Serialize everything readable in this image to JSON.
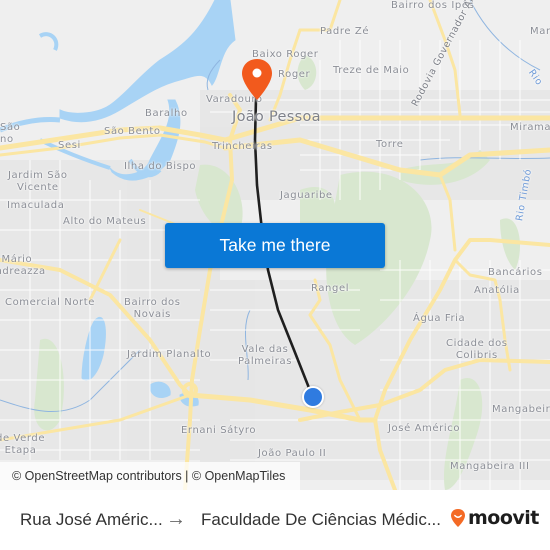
{
  "map": {
    "colors": {
      "land": "#efefef",
      "water": "#a8d3f5",
      "park": "#d6e6cc",
      "road_major": "#fbe6a2",
      "road_minor": "#ffffff",
      "route": "#1f1f1f",
      "destination_pin": "#f25a1d",
      "origin_dot": "#2f7be0"
    },
    "labels": {
      "joao_pessoa": "João Pessoa",
      "bairro_dos_ipes": "Bairro dos Ipês",
      "padre_ze": "Padre Zé",
      "baixo_roger": "Baixo Roger",
      "roger": "Roger",
      "treze_de_maio": "Treze de Maio",
      "varadouro": "Varadouro",
      "baralho": "Baralho",
      "sao_bento": "São Bento",
      "sesi": "Sesi",
      "sao_no": "São\nno",
      "trincheiras": "Trincheiras",
      "ilha_do_bispo": "Ilha do Bispo",
      "jardim_sao_vicente": "Jardim São\nVicente",
      "imaculada": "Imaculada",
      "alto_do_mateus": "Alto do Mateus",
      "mario_andreazza": "Mário\nAndreazza",
      "comercial_norte": "Comercial Norte",
      "bairro_dos_novais": "Bairro dos\nNovais",
      "jardim_planalto": "Jardim Planalto",
      "vale_das_palmeiras": "Vale das\nPalmeiras",
      "ernani_satyro": "Ernani Sátyro",
      "joao_paulo_ii": "João Paulo II",
      "verde_etapa": "de Verde\nEtapa",
      "jaguaribe": "Jaguaribe",
      "torre": "Torre",
      "miramar": "Miramar",
      "mar": "Mar",
      "rangel": "Rangel",
      "bancarios": "Bancários",
      "anatolia": "Anatólia",
      "agua_fria": "Água Fria",
      "cidade_dos_colibris": "Cidade dos\nColibris",
      "mangabeira": "Mangabeira",
      "jose_americo": "José Américo",
      "mangabeira_iii": "Mangabeira III",
      "rodovia": "Rodovia Governador Antônio Mariz",
      "rio_1": "Rio",
      "rio_timbo": "Rio Timbó"
    },
    "cta_label": "Take me there",
    "attribution": "© OpenStreetMap contributors | © OpenMapTiles"
  },
  "footer": {
    "from": "Rua José Améric...",
    "arrow": "→",
    "to": "Faculdade De Ciências Médic...",
    "brand": "moovit",
    "brand_color": "#f46a25"
  }
}
